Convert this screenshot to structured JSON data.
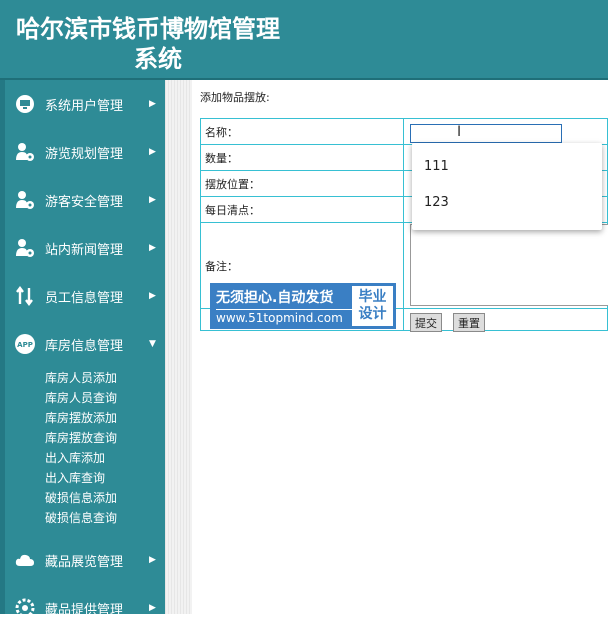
{
  "header": {
    "title_line1": "哈尔滨市钱币博物馆管理",
    "title_line2": "系统"
  },
  "sidebar": {
    "menus": [
      {
        "label": "系统用户管理",
        "icon": "monitor-icon",
        "arrow": "▶"
      },
      {
        "label": "游览规划管理",
        "icon": "user-gear-icon",
        "arrow": "▶"
      },
      {
        "label": "游客安全管理",
        "icon": "user-gear-icon",
        "arrow": "▶"
      },
      {
        "label": "站内新闻管理",
        "icon": "user-gear-icon",
        "arrow": "▶"
      },
      {
        "label": "员工信息管理",
        "icon": "transfer-icon",
        "arrow": "▶"
      },
      {
        "label": "库房信息管理",
        "icon": "app-icon",
        "arrow": "▼"
      },
      {
        "label": "藏品展览管理",
        "icon": "cloud-icon",
        "arrow": "▶"
      },
      {
        "label": "藏品提供管理",
        "icon": "gear-icon",
        "arrow": "▶"
      }
    ],
    "submenu": [
      "库房人员添加",
      "库房人员查询",
      "库房摆放添加",
      "库房摆放查询",
      "出入库添加",
      "出入库查询",
      "破损信息添加",
      "破损信息查询"
    ]
  },
  "form": {
    "page_label": "添加物品摆放:",
    "rows": [
      "名称：",
      "数量：",
      "摆放位置：",
      "每日清点：",
      "备注："
    ],
    "name_value": "",
    "submit_label": "提交",
    "reset_label": "重置",
    "dropdown_options": [
      "111",
      "123"
    ]
  },
  "banner": {
    "line1": "无须担心.自动发货",
    "line2": "www.51topmind.com",
    "badge_line1": "毕业",
    "badge_line2": "设计"
  }
}
